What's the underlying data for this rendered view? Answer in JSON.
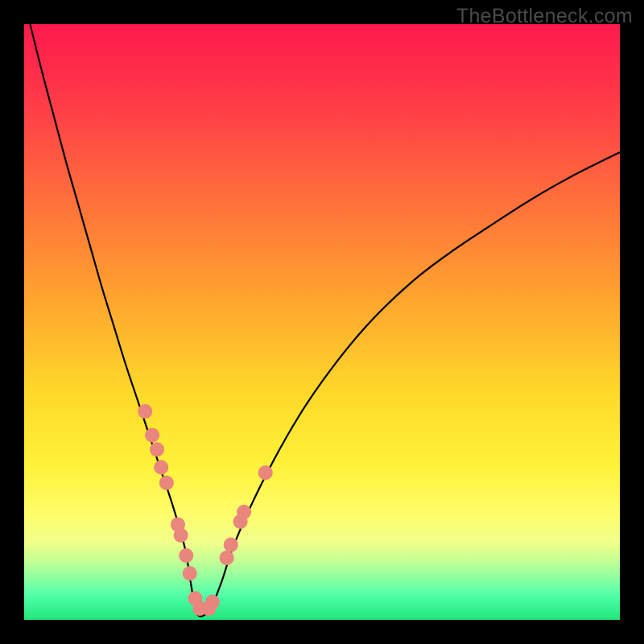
{
  "watermark": "TheBottleneck.com",
  "colors": {
    "frame": "#000000",
    "curve_stroke": "#000000",
    "marker_fill": "#e9867d",
    "marker_stroke": "#d66a60"
  },
  "chart_data": {
    "type": "line",
    "title": "",
    "xlabel": "",
    "ylabel": "",
    "xlim": [
      0,
      100
    ],
    "ylim": [
      0,
      100
    ],
    "grid": false,
    "legend": false,
    "series": [
      {
        "name": "bottleneck-curve",
        "x": [
          1,
          3,
          5,
          7,
          9,
          11,
          13,
          15,
          17,
          19,
          21,
          23,
          25,
          27,
          28,
          29,
          31,
          33,
          35,
          38,
          42,
          46,
          50,
          55,
          60,
          66,
          72,
          78,
          85,
          92,
          100
        ],
        "y": [
          100,
          92,
          84.5,
          77,
          70,
          63,
          56,
          49.5,
          43,
          37,
          31,
          25,
          19,
          12,
          6,
          1,
          1.5,
          6,
          12,
          19,
          27,
          34,
          40,
          46.5,
          52,
          57.5,
          62,
          66,
          70.5,
          74.5,
          78.5
        ]
      }
    ],
    "markers": {
      "name": "highlight-points",
      "x": [
        20.3,
        21.5,
        22.3,
        23.0,
        23.9,
        25.8,
        26.3,
        27.2,
        27.8,
        28.7,
        29.5,
        31.0,
        31.6,
        34.0,
        34.7,
        36.3,
        36.9,
        40.5
      ],
      "y": [
        35.0,
        31.0,
        28.6,
        25.6,
        23.0,
        16.0,
        14.2,
        10.8,
        7.8,
        3.6,
        1.9,
        1.9,
        3.0,
        10.4,
        12.6,
        16.5,
        18.1,
        24.7
      ]
    }
  }
}
